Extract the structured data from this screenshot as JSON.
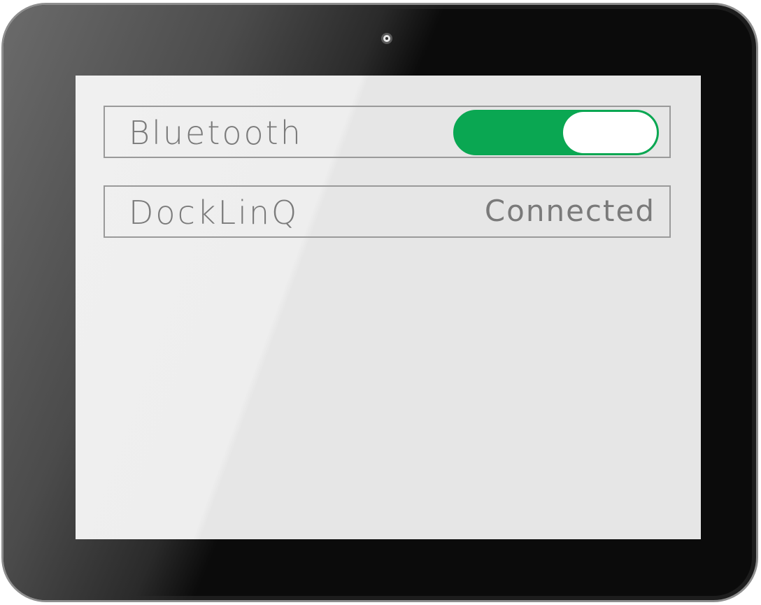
{
  "screen": {
    "bluetooth": {
      "label": "Bluetooth",
      "toggle_on": true,
      "toggle_color": "#0aa752"
    },
    "device": {
      "name": "DockLinQ",
      "status": "Connected"
    }
  },
  "device_frame": {
    "camera_icon": "camera-icon"
  }
}
